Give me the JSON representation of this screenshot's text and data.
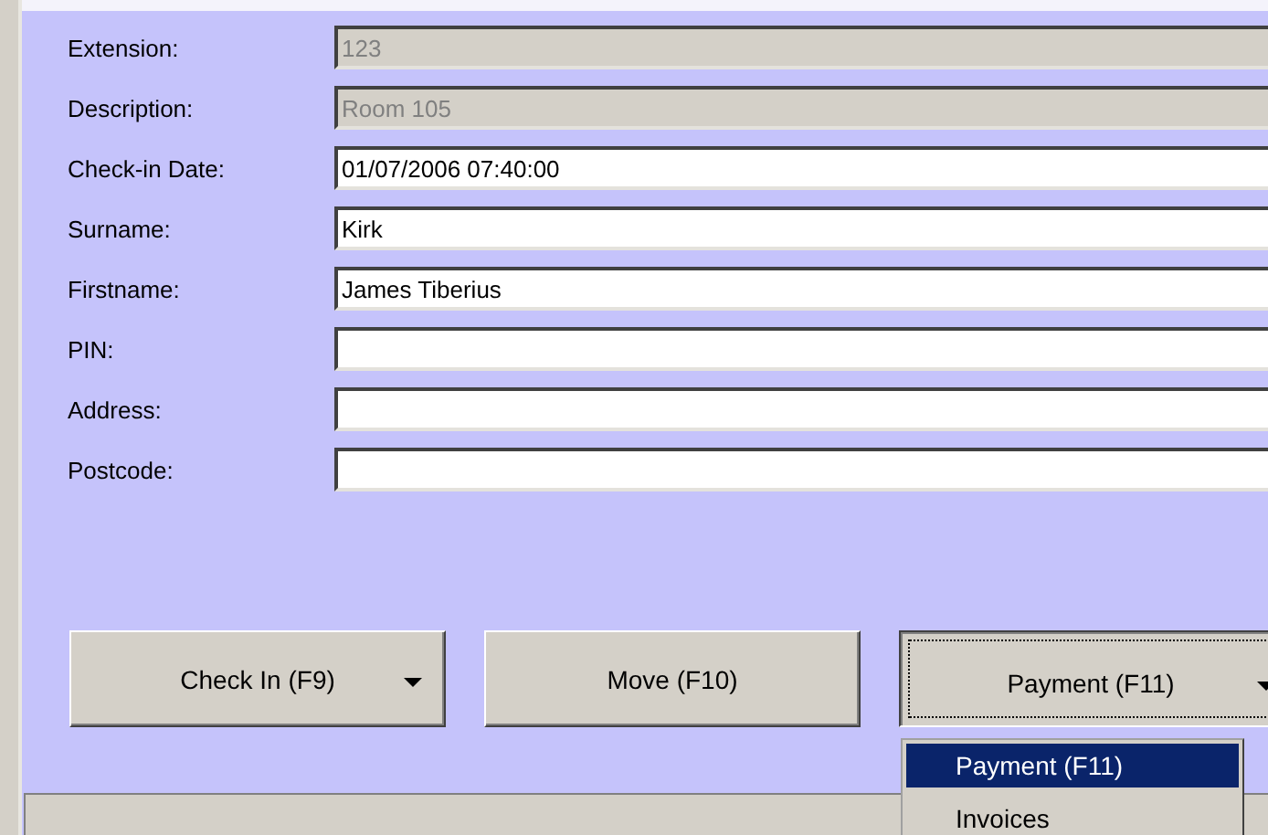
{
  "fields": [
    {
      "label": "Extension:",
      "value": "123",
      "disabled": true
    },
    {
      "label": "Description:",
      "value": "Room 105",
      "disabled": true
    },
    {
      "label": "Check-in Date:",
      "value": "01/07/2006 07:40:00",
      "disabled": false
    },
    {
      "label": "Surname:",
      "value": "Kirk",
      "disabled": false
    },
    {
      "label": "Firstname:",
      "value": "James Tiberius",
      "disabled": false
    },
    {
      "label": "PIN:",
      "disabled": false
    },
    {
      "label": "Address:",
      "disabled": false
    },
    {
      "label": "Postcode:",
      "disabled": false
    }
  ],
  "buttons": [
    {
      "label": "Check In (F9)",
      "dropdown": true,
      "pressed": false
    },
    {
      "label": "Move (F10)",
      "dropdown": false,
      "pressed": false
    },
    {
      "label": "Payment (F11)",
      "dropdown": true,
      "pressed": true
    }
  ],
  "menu": [
    {
      "label": "Payment (F11)",
      "selected": true
    },
    {
      "label": "Invoices",
      "selected": false
    }
  ]
}
